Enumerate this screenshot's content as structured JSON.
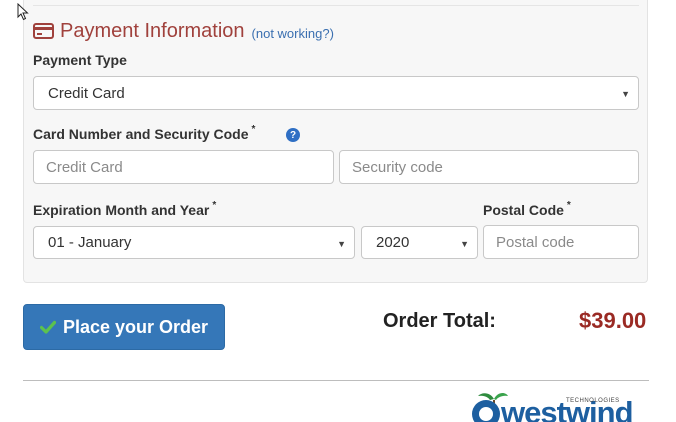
{
  "payment": {
    "title": "Payment Information",
    "help_link": "(not working?)",
    "payment_type_label": "Payment Type",
    "payment_type_value": "Credit Card",
    "card_label": "Card Number and Security Code",
    "card_required": "*",
    "card_number_placeholder": "Credit Card",
    "security_code_placeholder": "Security code",
    "expiration_label": "Expiration Month and Year",
    "expiration_required": "*",
    "month_value": "01 - January",
    "year_value": "2020",
    "postal_label": "Postal Code",
    "postal_required": "*",
    "postal_placeholder": "Postal code"
  },
  "order": {
    "button_label": "Place your Order",
    "total_label": "Order Total:",
    "total_value": "$39.00"
  },
  "logo": {
    "name": "westwind",
    "tagline": "TECHNOLOGIES"
  },
  "colors": {
    "heading": "#a0413c",
    "button": "#3577b8",
    "total": "#9a2a24",
    "check": "#5cc24e"
  }
}
